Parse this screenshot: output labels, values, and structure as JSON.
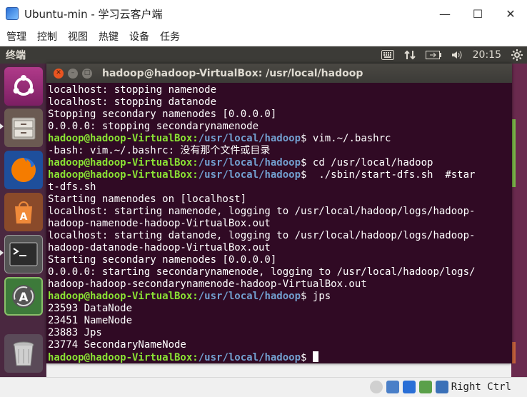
{
  "window": {
    "title": "Ubuntu-min - 学习云客户端",
    "minimize_icon": "minimize-icon",
    "maximize_icon": "maximize-icon",
    "close_icon": "close-icon"
  },
  "menubar": {
    "items": [
      "管理",
      "控制",
      "视图",
      "热键",
      "设备",
      "任务"
    ]
  },
  "topbar": {
    "app_title": "终端",
    "clock": "20:15"
  },
  "terminal": {
    "title": "hadoop@hadoop-VirtualBox: /usr/local/hadoop",
    "prompt_user": "hadoop@hadoop-VirtualBox",
    "prompt_path": "/usr/local/hadoop",
    "lines": [
      {
        "text": "localhost: stopping namenode"
      },
      {
        "text": "localhost: stopping datanode"
      },
      {
        "text": "Stopping secondary namenodes [0.0.0.0]"
      },
      {
        "text": "0.0.0.0: stopping secondarynamenode"
      },
      {
        "prompt": true,
        "text": " vim.~/.bashrc"
      },
      {
        "text": "-bash: vim.~/.bashrc: 没有那个文件或目录"
      },
      {
        "prompt": true,
        "text": " cd /usr/local/hadoop"
      },
      {
        "prompt": true,
        "text": "  ./sbin/start-dfs.sh  #star"
      },
      {
        "text": "t-dfs.sh"
      },
      {
        "text": "Starting namenodes on [localhost]"
      },
      {
        "text": "localhost: starting namenode, logging to /usr/local/hadoop/logs/hadoop-"
      },
      {
        "text": "hadoop-namenode-hadoop-VirtualBox.out"
      },
      {
        "text": "localhost: starting datanode, logging to /usr/local/hadoop/logs/hadoop-"
      },
      {
        "text": "hadoop-datanode-hadoop-VirtualBox.out"
      },
      {
        "text": "Starting secondary namenodes [0.0.0.0]"
      },
      {
        "text": "0.0.0.0: starting secondarynamenode, logging to /usr/local/hadoop/logs/"
      },
      {
        "text": "hadoop-hadoop-secondarynamenode-hadoop-VirtualBox.out"
      },
      {
        "prompt": true,
        "text": " jps"
      },
      {
        "text": "23593 DataNode"
      },
      {
        "text": "23451 NameNode"
      },
      {
        "text": "23883 Jps"
      },
      {
        "text": "23774 SecondaryNameNode"
      },
      {
        "prompt": true,
        "text": " ",
        "cursor": true
      }
    ]
  },
  "statusbar": {
    "host_key": "Right Ctrl"
  },
  "colors": {
    "terminal_bg": "#300a24",
    "prompt_user": "#8ae234",
    "prompt_path": "#729fcf",
    "launcher_bg": "#4a2840",
    "ubuntu_orange": "#e95420"
  }
}
